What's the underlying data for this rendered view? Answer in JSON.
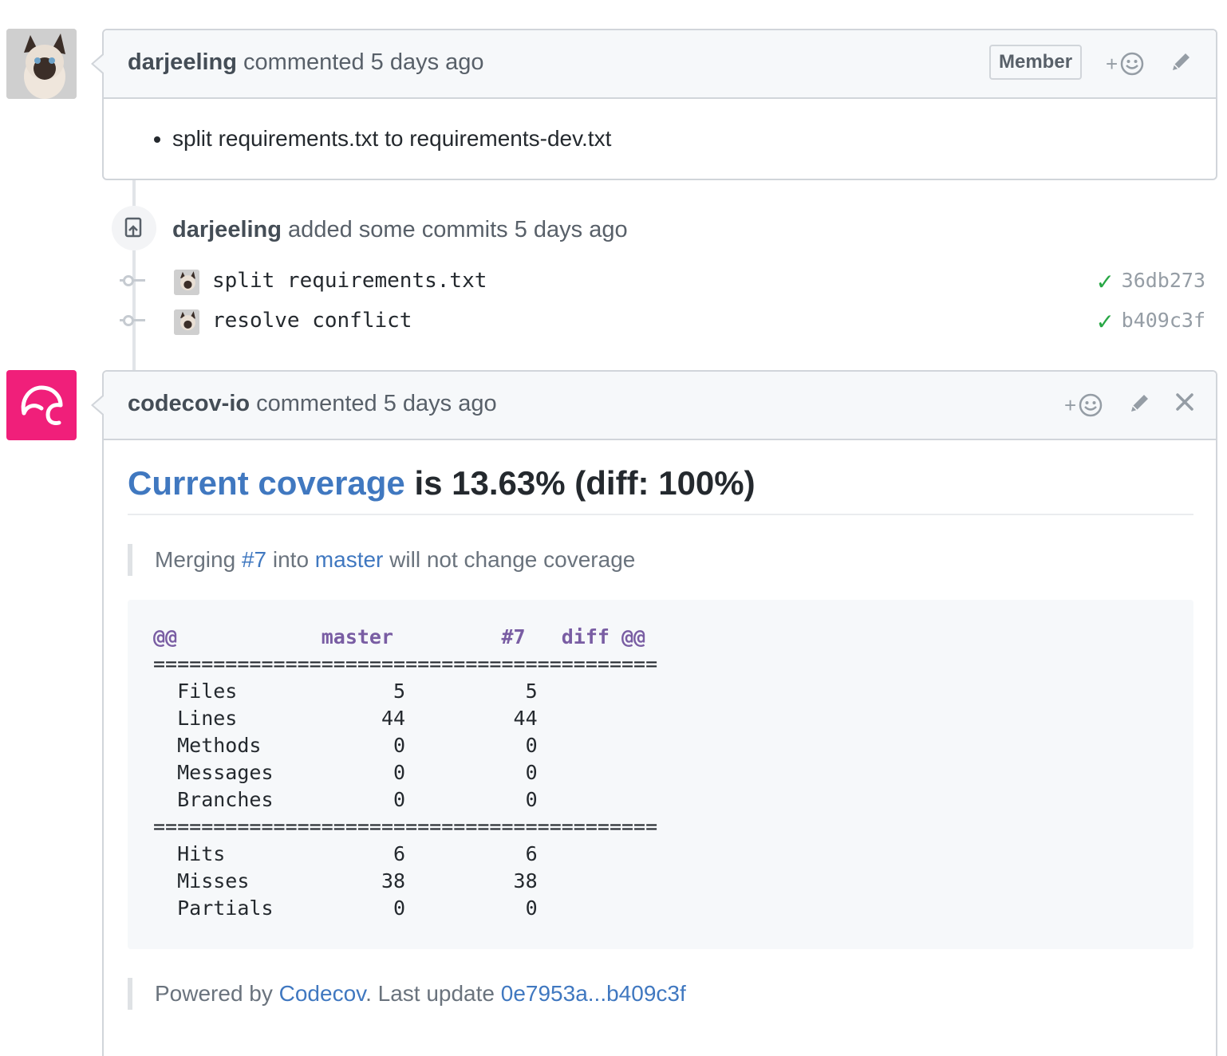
{
  "comment1": {
    "author": "darjeeling",
    "action_text": " commented 5 days ago",
    "badge": "Member",
    "body_item": "split requirements.txt to requirements-dev.txt"
  },
  "commits_event": {
    "author": "darjeeling",
    "action_text": " added some commits 5 days ago",
    "commits": [
      {
        "message": "split requirements.txt",
        "sha": "36db273",
        "status": "success"
      },
      {
        "message": "resolve conflict",
        "sha": "b409c3f",
        "status": "success"
      }
    ]
  },
  "comment2": {
    "author": "codecov-io",
    "action_text": " commented 5 days ago",
    "coverage_link": "Current coverage",
    "coverage_text": " is 13.63% (diff: 100%)",
    "merge_prefix": "Merging ",
    "merge_pr": "#7",
    "merge_mid": " into ",
    "merge_branch": "master",
    "merge_suffix": " will not change coverage",
    "code_header": "@@            master         #7   diff @@",
    "code_separator": "==========================================",
    "code_rows_1": [
      "  Files             5          5          ",
      "  Lines            44         44          ",
      "  Methods           0          0          ",
      "  Messages          0          0          ",
      "  Branches          0          0          "
    ],
    "code_rows_2": [
      "  Hits              6          6          ",
      "  Misses           38         38          ",
      "  Partials          0          0          "
    ],
    "footer_prefix": "Powered by ",
    "footer_link": "Codecov",
    "footer_mid": ". Last update ",
    "footer_range": "0e7953a...b409c3f"
  },
  "colors": {
    "link": "#4078c0",
    "success": "#28a745",
    "codecov_brand": "#f01f7a",
    "code_keyword": "#795da3"
  },
  "icons": {
    "reaction": "smiley-icon",
    "edit": "pencil-icon",
    "close": "x-icon",
    "commit": "git-commit-icon",
    "repo_push": "repo-push-icon",
    "check": "check-icon"
  }
}
